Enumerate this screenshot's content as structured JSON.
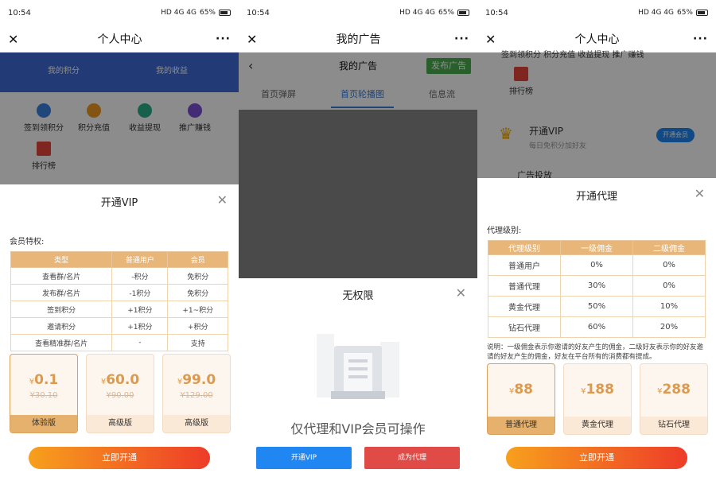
{
  "status": {
    "p1": {
      "time": "10:54",
      "speed": "1.70\nKB/S",
      "battery": "65%"
    },
    "p2": {
      "time": "10:54",
      "speed": "1.75\nKB/S",
      "battery": "65%"
    },
    "p3": {
      "time": "10:54",
      "speed": "0.83\nKB/S",
      "battery": "65%"
    },
    "net": "HD 4G 4G",
    "extra": "90"
  },
  "panel1": {
    "title": "个人中心",
    "bg_labels": [
      "我的积分",
      "我的收益"
    ],
    "quick": [
      "签到领积分",
      "积分充值",
      "收益提现",
      "推广赚钱",
      "排行榜"
    ],
    "sheet_title": "开通VIP",
    "section_label": "会员特权:",
    "table_head": [
      "类型",
      "普通用户",
      "会员"
    ],
    "table_rows": [
      [
        "查看群/名片",
        "-积分",
        "免积分"
      ],
      [
        "发布群/名片",
        "-1积分",
        "免积分"
      ],
      [
        "签到积分",
        "+1积分",
        "+1~积分"
      ],
      [
        "邀请积分",
        "+1积分",
        "+积分"
      ],
      [
        "查看精准群/名片",
        "-",
        "支持"
      ]
    ],
    "plans": [
      {
        "currency": "¥",
        "price": "0.1",
        "old": "¥30.10",
        "name": "体验版"
      },
      {
        "currency": "¥",
        "price": "60.0",
        "old": "¥90.00",
        "name": "高级版"
      },
      {
        "currency": "¥",
        "price": "99.0",
        "old": "¥129.00",
        "name": "高级版"
      }
    ],
    "cta": "立即开通"
  },
  "panel2": {
    "title": "我的广告",
    "inner_title": "我的广告",
    "publish": "发布广告",
    "tabs": [
      "首页弹屏",
      "首页轮播图",
      "信息流"
    ],
    "sheet_title": "无权限",
    "message": "仅代理和VIP会员可操作",
    "btn_vip": "开通VIP",
    "btn_agent": "成为代理",
    "colors": {
      "blue": "#1f86f2",
      "red": "#e14b47"
    }
  },
  "panel3": {
    "title": "个人中心",
    "bg_top": "签到领积分    积分充值    收益提现    推广赚钱",
    "rank": "排行榜",
    "vip_title": "开通VIP",
    "vip_sub": "每日免积分加好友",
    "vip_btn": "开通会员",
    "bg_bottom": "广告投放",
    "sheet_title": "开通代理",
    "level_label": "代理级别:",
    "table_head": [
      "代理级别",
      "一级佣金",
      "二级佣金"
    ],
    "table_rows": [
      [
        "普通用户",
        "0%",
        "0%"
      ],
      [
        "普通代理",
        "30%",
        "0%"
      ],
      [
        "黄金代理",
        "50%",
        "10%"
      ],
      [
        "钻石代理",
        "60%",
        "20%"
      ]
    ],
    "note": "说明：一级佣金表示你邀请的好友产生的佣金，二级好友表示你的好友邀请的好友产生的佣金，好友在平台所有的消费都有提成。",
    "plans": [
      {
        "currency": "¥",
        "price": "88",
        "name": "普通代理"
      },
      {
        "currency": "¥",
        "price": "188",
        "name": "黄金代理"
      },
      {
        "currency": "¥",
        "price": "288",
        "name": "钻石代理"
      }
    ],
    "cta": "立即开通"
  }
}
